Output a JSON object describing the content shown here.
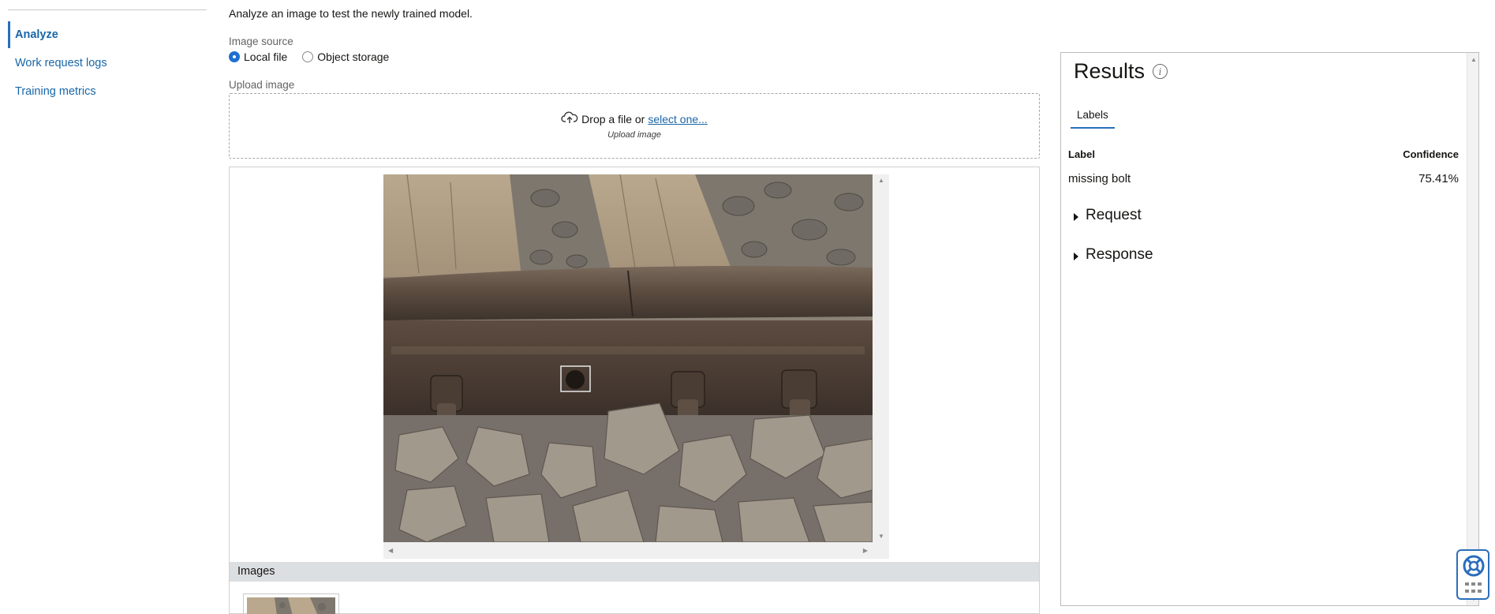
{
  "sidebar": {
    "items": [
      {
        "label": "Analyze",
        "active": true
      },
      {
        "label": "Work request logs",
        "active": false
      },
      {
        "label": "Training metrics",
        "active": false
      }
    ]
  },
  "main": {
    "intro": "Analyze an image to test the newly trained model.",
    "image_source": {
      "label": "Image source",
      "options": [
        {
          "label": "Local file",
          "selected": true
        },
        {
          "label": "Object storage",
          "selected": false
        }
      ]
    },
    "upload": {
      "label": "Upload image",
      "drop_text": "Drop a file or",
      "link_text": "select one...",
      "sub_text": "Upload image"
    },
    "images_bar_label": "Images"
  },
  "results": {
    "title": "Results",
    "tab_label": "Labels",
    "columns": {
      "label": "Label",
      "confidence": "Confidence"
    },
    "rows": [
      {
        "label": "missing bolt",
        "confidence": "75.41%"
      }
    ],
    "sections": [
      {
        "label": "Request",
        "expanded": false
      },
      {
        "label": "Response",
        "expanded": false
      }
    ]
  },
  "colors": {
    "link": "#1866a8",
    "accent": "#2a6ebb",
    "radio_selected": "#1e6fd0"
  }
}
